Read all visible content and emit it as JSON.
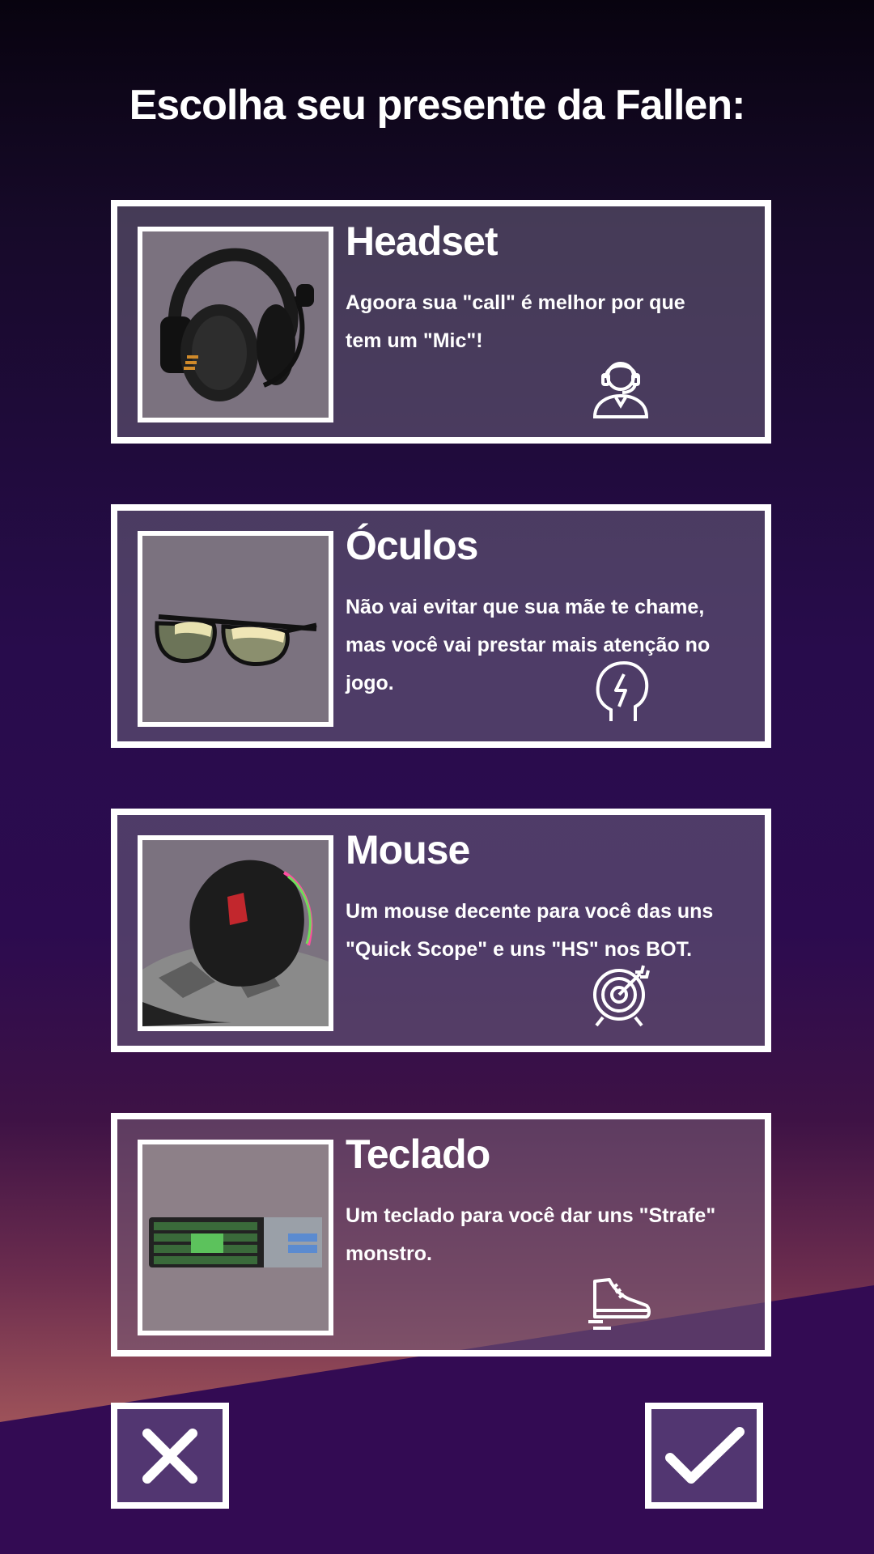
{
  "page": {
    "title": "Escolha seu presente da Fallen:"
  },
  "options": [
    {
      "title": "Headset",
      "description": "Agoora sua \"call\" é melhor por que tem um \"Mic\"!",
      "icon": "headset-user-icon"
    },
    {
      "title": "Óculos",
      "description": "Não vai evitar que sua mãe te chame, mas você vai prestar mais atenção no jogo.",
      "icon": "brain-lightning-icon"
    },
    {
      "title": "Mouse",
      "description": "Um mouse decente para você das uns \"Quick Scope\" e uns \"HS\" nos BOT.",
      "icon": "target-icon"
    },
    {
      "title": "Teclado",
      "description": "Um teclado para você dar uns \"Strafe\" monstro.",
      "icon": "running-shoe-icon"
    }
  ],
  "actions": {
    "cancel_icon": "close-icon",
    "confirm_icon": "check-icon"
  },
  "colors": {
    "button_bg": "#523671",
    "border": "#ffffff",
    "accent_dark": "#330b53"
  }
}
